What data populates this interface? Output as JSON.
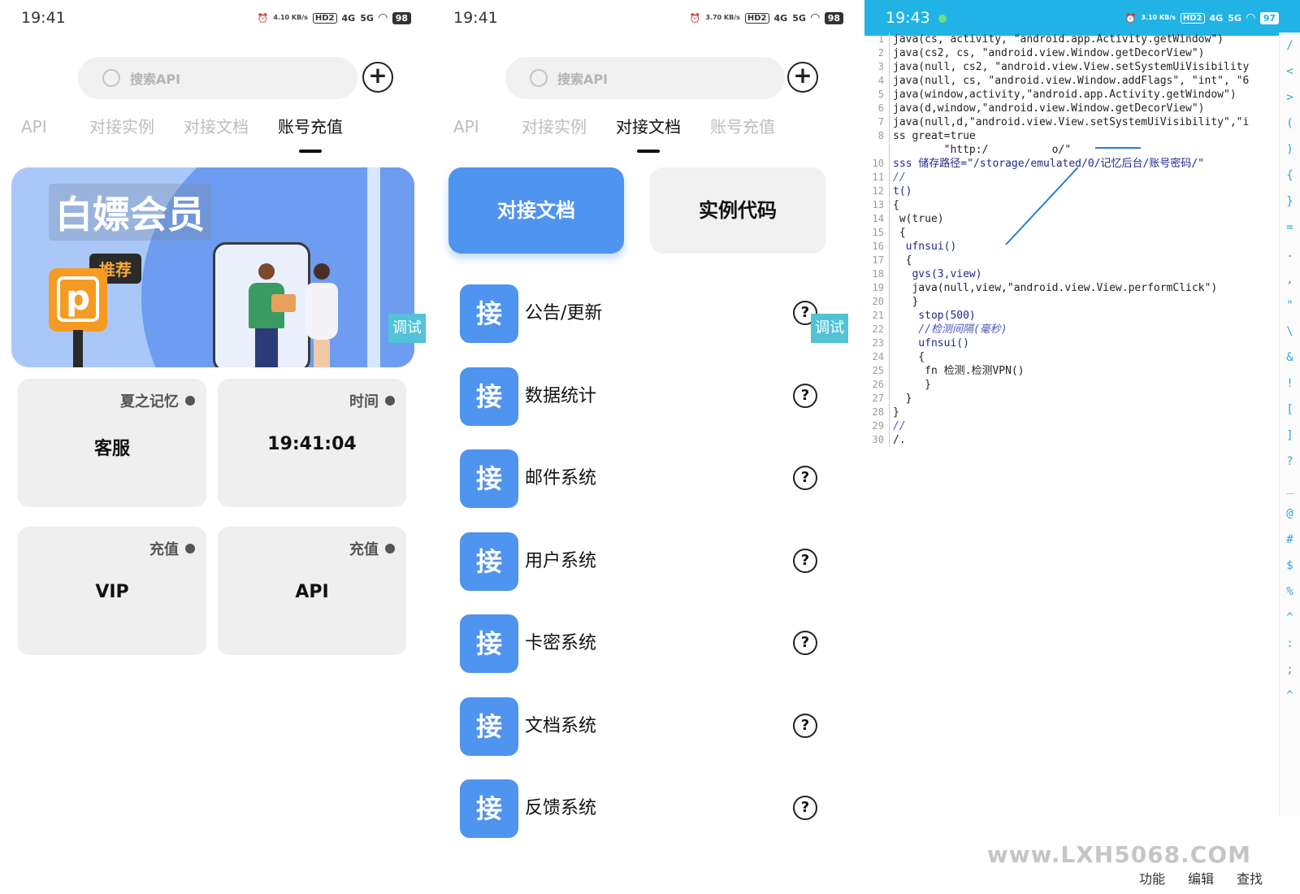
{
  "phone1": {
    "status": {
      "time": "19:41",
      "speed": "4.10 KB/s",
      "hd": "HD2",
      "net1": "4G",
      "net2": "5G",
      "battery": "98"
    },
    "search": {
      "placeholder": "搜索API"
    },
    "add_icon": "plus-circle-icon",
    "tabs": [
      "API",
      "对接实例",
      "对接文档",
      "账号充值"
    ],
    "active_tab": 3,
    "banner": {
      "title": "白嫖会员",
      "tag": "推荐",
      "sign_letter": "p"
    },
    "debug_label": "调试",
    "cards": [
      {
        "top": "夏之记忆",
        "main": "客服"
      },
      {
        "top": "时间",
        "main": "19:41:04"
      },
      {
        "top": "充值",
        "main": "VIP"
      },
      {
        "top": "充值",
        "main": "API"
      }
    ]
  },
  "phone2": {
    "status": {
      "time": "19:41",
      "speed": "3.70 KB/s",
      "hd": "HD2",
      "net1": "4G",
      "net2": "5G",
      "battery": "98"
    },
    "search": {
      "placeholder": "搜索API"
    },
    "tabs": [
      "API",
      "对接实例",
      "对接文档",
      "账号充值"
    ],
    "active_tab": 2,
    "segments": [
      "对接文档",
      "实例代码"
    ],
    "badge_char": "接",
    "rows": [
      "公告/更新",
      "数据统计",
      "邮件系统",
      "用户系统",
      "卡密系统",
      "文档系统",
      "反馈系统"
    ],
    "help_symbol": "?",
    "debug_label": "调试"
  },
  "phone3": {
    "status": {
      "time": "19:43",
      "speed": "3.10 KB/s",
      "hd": "HD2",
      "net1": "4G",
      "net2": "5G",
      "battery": "97"
    },
    "code_lines": [
      {
        "n": "1",
        "t": "java(cs, activity, \"android.app.Activity.getWindow\")",
        "c": ""
      },
      {
        "n": "2",
        "t": "java(cs2, cs, \"android.view.Window.getDecorView\")",
        "c": ""
      },
      {
        "n": "3",
        "t": "java(null, cs2, \"android.view.View.setSystemUiVisibility",
        "c": ""
      },
      {
        "n": "4",
        "t": "java(null, cs, \"android.view.Window.addFlags\", \"int\", \"6",
        "c": ""
      },
      {
        "n": "5",
        "t": "java(window,activity,\"android.app.Activity.getWindow\")",
        "c": ""
      },
      {
        "n": "6",
        "t": "java(d,window,\"android.view.Window.getDecorView\")",
        "c": ""
      },
      {
        "n": "7",
        "t": "java(null,d,\"android.view.View.setSystemUiVisibility\",\"i",
        "c": ""
      },
      {
        "n": "8",
        "t": "ss great=true",
        "c": ""
      },
      {
        "n": "",
        "t": "        \"http:/          o/\"",
        "c": ""
      },
      {
        "n": "10",
        "t": "sss 储存路径=\"/storage/emulated/0/记忆后台/账号密码/\"",
        "c": "kw"
      },
      {
        "n": "11",
        "t": "//",
        "c": "cm"
      },
      {
        "n": "12",
        "t": "t()",
        "c": "kw"
      },
      {
        "n": "13",
        "t": "{",
        "c": ""
      },
      {
        "n": "14",
        "t": " w(true)",
        "c": ""
      },
      {
        "n": "15",
        "t": " {",
        "c": ""
      },
      {
        "n": "16",
        "t": "  ufnsui()",
        "c": "kw"
      },
      {
        "n": "17",
        "t": "  {",
        "c": ""
      },
      {
        "n": "18",
        "t": "   gvs(3,view)",
        "c": "kw"
      },
      {
        "n": "19",
        "t": "   java(null,view,\"android.view.View.performClick\")",
        "c": ""
      },
      {
        "n": "20",
        "t": "   }",
        "c": ""
      },
      {
        "n": "21",
        "t": "    stop(500)",
        "c": "kw"
      },
      {
        "n": "22",
        "t": "    //检测间隔(毫秒)",
        "c": "cm"
      },
      {
        "n": "23",
        "t": "    ufnsui()",
        "c": "kw"
      },
      {
        "n": "24",
        "t": "    {",
        "c": ""
      },
      {
        "n": "25",
        "t": "     fn 检测.检测VPN()",
        "c": ""
      },
      {
        "n": "26",
        "t": "     }",
        "c": ""
      },
      {
        "n": "27",
        "t": "  }",
        "c": ""
      },
      {
        "n": "28",
        "t": "}",
        "c": ""
      },
      {
        "n": "29",
        "t": "//",
        "c": "cm"
      },
      {
        "n": "30",
        "t": "/.",
        "c": ""
      }
    ],
    "side_symbols": [
      "/",
      "<",
      ">",
      "(",
      ")",
      "{",
      "}",
      "=",
      ".",
      ",",
      "\"",
      "\\",
      "&",
      "!",
      "[",
      "]",
      "?",
      "_",
      "@",
      "#",
      "$",
      "%",
      "^",
      ":",
      ";",
      "^"
    ],
    "bottom_menu": [
      "功能",
      "编辑",
      "查找"
    ],
    "watermark": "www.LXH5068.COM"
  },
  "colors": {
    "accent_blue": "#4f94ee",
    "statusbar_cyan": "#21b3e6",
    "debug_cyan": "#52c3d6"
  }
}
